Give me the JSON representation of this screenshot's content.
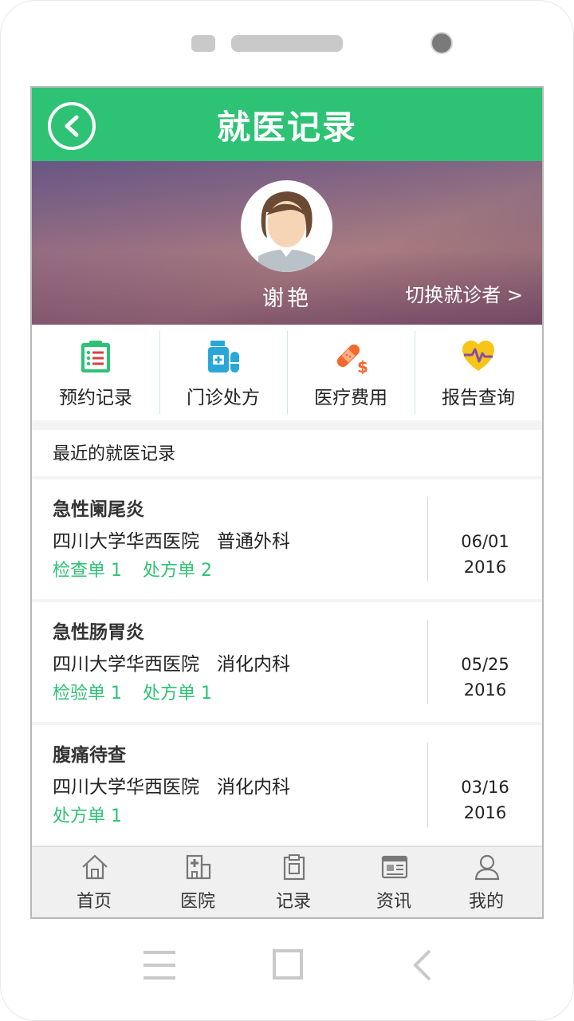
{
  "header": {
    "title": "就医记录",
    "back_icon": "back-chevron-icon"
  },
  "patient": {
    "name": "谢艳",
    "switch_label": "切换就诊者 >"
  },
  "quick_actions": [
    {
      "label": "预约记录",
      "icon": "clipboard-list-icon",
      "color": "#2ec274"
    },
    {
      "label": "门诊处方",
      "icon": "medicine-bottle-icon",
      "color": "#29a8d8"
    },
    {
      "label": "医疗费用",
      "icon": "bandage-dollar-icon",
      "color": "#f26a2c"
    },
    {
      "label": "报告查询",
      "icon": "heart-pulse-icon",
      "color": "#f5c518"
    }
  ],
  "recent": {
    "heading": "最近的就医记录",
    "records": [
      {
        "diagnosis": "急性阑尾炎",
        "hospital": "四川大学华西医院",
        "department": "普通外科",
        "links": [
          "检查单 1",
          "处方单 2"
        ],
        "date_md": "06/01",
        "year": "2016"
      },
      {
        "diagnosis": "急性肠胃炎",
        "hospital": "四川大学华西医院",
        "department": "消化内科",
        "links": [
          "检验单 1",
          "处方单 1"
        ],
        "date_md": "05/25",
        "year": "2016"
      },
      {
        "diagnosis": "腹痛待查",
        "hospital": "四川大学华西医院",
        "department": "消化内科",
        "links": [
          "处方单 1"
        ],
        "date_md": "03/16",
        "year": "2016"
      }
    ]
  },
  "tabbar": [
    {
      "label": "首页",
      "icon": "home-icon"
    },
    {
      "label": "医院",
      "icon": "hospital-icon"
    },
    {
      "label": "记录",
      "icon": "clipboard-icon"
    },
    {
      "label": "资讯",
      "icon": "news-icon"
    },
    {
      "label": "我的",
      "icon": "user-icon"
    }
  ],
  "colors": {
    "accent": "#2ec274",
    "link": "#2ec274"
  }
}
